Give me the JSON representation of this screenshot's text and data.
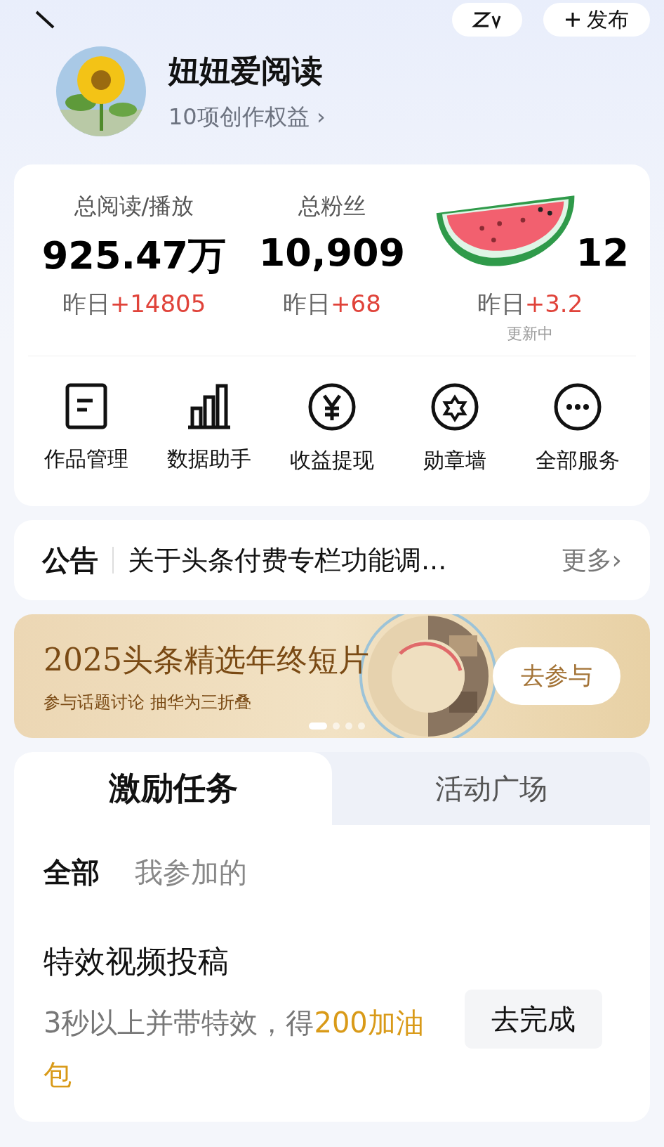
{
  "header": {
    "publish_label": "发布"
  },
  "profile": {
    "name": "妞妞爱阅读",
    "benefits": "10项创作权益",
    "benefits_arrow": "›"
  },
  "stats": [
    {
      "label": "总阅读/播放",
      "value": "925.47万",
      "prefix": "昨日",
      "delta": "+14805"
    },
    {
      "label": "总粉丝",
      "value": "10,909",
      "prefix": "昨日",
      "delta": "+68"
    },
    {
      "value": "12",
      "prefix": "昨日",
      "delta": "+3.2",
      "note": "更新中"
    }
  ],
  "services": [
    {
      "label": "作品管理"
    },
    {
      "label": "数据助手"
    },
    {
      "label": "收益提现"
    },
    {
      "label": "勋章墙"
    },
    {
      "label": "全部服务"
    }
  ],
  "notice": {
    "tag": "公告",
    "text": "关于头条付费专栏功能调...",
    "more": "更多›"
  },
  "banner": {
    "title": "2025头条精选年终短片",
    "subtitle": "参与话题讨论 抽华为三折叠",
    "button": "去参与",
    "dots": [
      {
        "selected": true
      },
      {
        "selected": false
      },
      {
        "selected": false
      },
      {
        "selected": false
      }
    ]
  },
  "tabs": [
    {
      "label": "激励任务",
      "selected": true
    },
    {
      "label": "活动广场",
      "selected": false
    }
  ],
  "filters": [
    {
      "label": "全部",
      "selected": true
    },
    {
      "label": "我参加的",
      "selected": false
    }
  ],
  "tasks": [
    {
      "title": "特效视频投稿",
      "description": "3秒以上并带特效，得**200加油包**",
      "button": "去完成"
    }
  ]
}
